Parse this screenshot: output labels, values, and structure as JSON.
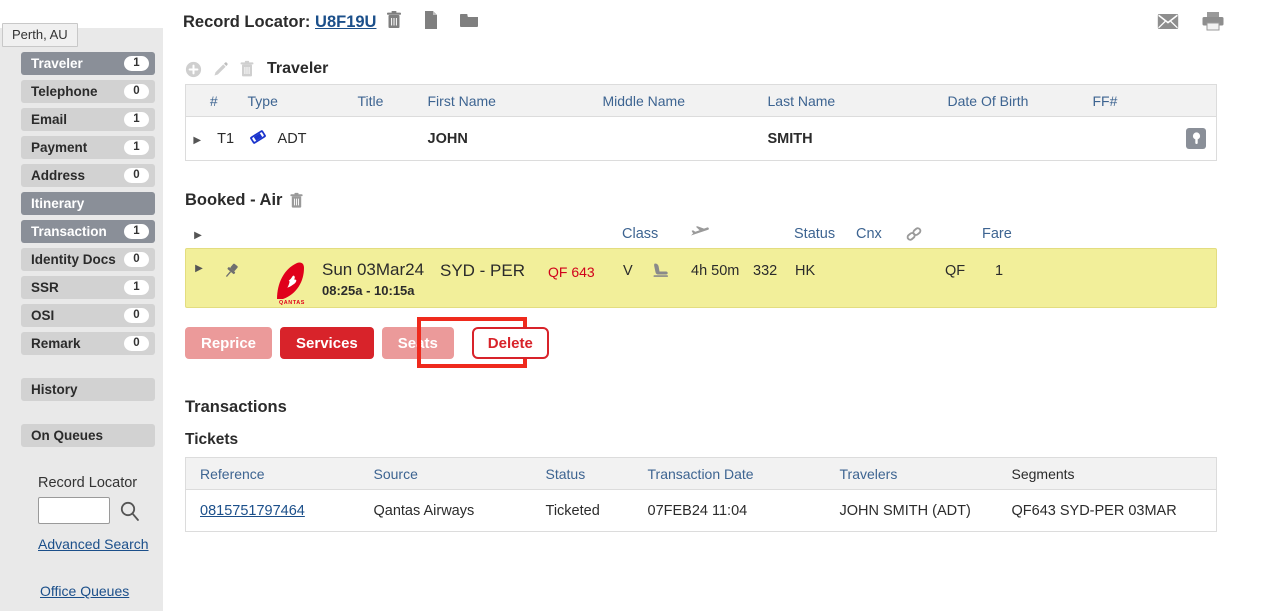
{
  "tooltip": {
    "text": "Perth, AU"
  },
  "sidebar": {
    "items": [
      {
        "label": "Traveler",
        "count": "1",
        "selected": true
      },
      {
        "label": "Telephone",
        "count": "0",
        "selected": false
      },
      {
        "label": "Email",
        "count": "1",
        "selected": false
      },
      {
        "label": "Payment",
        "count": "1",
        "selected": false
      },
      {
        "label": "Address",
        "count": "0",
        "selected": false
      },
      {
        "label": "Itinerary",
        "count": "",
        "selected": true
      },
      {
        "label": "Transaction",
        "count": "1",
        "selected": true
      },
      {
        "label": "Identity Docs",
        "count": "0",
        "selected": false
      },
      {
        "label": "SSR",
        "count": "1",
        "selected": false
      },
      {
        "label": "OSI",
        "count": "0",
        "selected": false
      },
      {
        "label": "Remark",
        "count": "0",
        "selected": false
      }
    ],
    "history_label": "History",
    "on_queues_label": "On Queues",
    "search": {
      "label": "Record Locator",
      "value": "",
      "placeholder": "",
      "icon": "search-icon"
    },
    "advanced_search_label": "Advanced Search",
    "office_queues_label": "Office Queues"
  },
  "header": {
    "record_locator_label": "Record Locator:",
    "record_locator_value": "U8F19U",
    "icons": [
      "trash-icon",
      "document-icon",
      "folder-icon"
    ],
    "right_icons": [
      "email-icon",
      "print-icon"
    ]
  },
  "traveler": {
    "section_title": "Traveler",
    "tools": [
      "add-icon",
      "edit-icon",
      "delete-icon"
    ],
    "columns": [
      "#",
      "Type",
      "Title",
      "First Name",
      "Middle Name",
      "Last Name",
      "Date Of Birth",
      "FF#"
    ],
    "rows": [
      {
        "num": "T1",
        "type": "ADT",
        "title": "",
        "first_name": "JOHN",
        "middle_name": "",
        "last_name": "SMITH",
        "dob": "",
        "ff": ""
      }
    ]
  },
  "booked_air": {
    "title": "Booked - Air",
    "columns": {
      "class": "Class",
      "plane": "plane-icon",
      "status": "Status",
      "cnx": "Cnx",
      "link": "link-icon",
      "fare": "Fare"
    },
    "segments": [
      {
        "carrier_logo": "qantas-logo",
        "date": "Sun 03Mar24",
        "times": "08:25a - 10:15a",
        "route": "SYD - PER",
        "flight": "QF 643",
        "class": "V",
        "duration": "4h 50m",
        "equipment": "332",
        "status": "HK",
        "cnx": "",
        "fare_carrier": "QF",
        "fare_num": "1"
      }
    ]
  },
  "actions": {
    "reprice": "Reprice",
    "services": "Services",
    "seats": "Seats",
    "delete": "Delete",
    "highlight_color": "#ef2a1d"
  },
  "transactions": {
    "title": "Transactions",
    "tickets_title": "Tickets",
    "columns": [
      "Reference",
      "Source",
      "Status",
      "Transaction Date",
      "Travelers",
      "Segments"
    ],
    "rows": [
      {
        "reference": "0815751797464",
        "source": "Qantas Airways",
        "status": "Ticketed",
        "transaction_date": "07FEB24 11:04",
        "travelers": "JOHN SMITH (ADT)",
        "segments": "QF643 SYD-PER 03MAR"
      }
    ]
  }
}
